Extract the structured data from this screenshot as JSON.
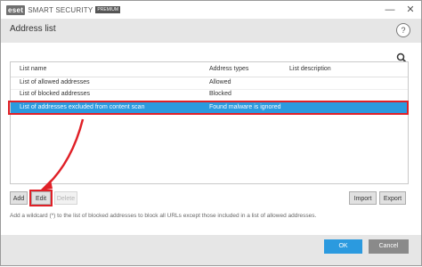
{
  "window": {
    "logo_mark": "eset",
    "product_name": "SMART SECURITY",
    "edition_badge": "PREMIUM",
    "minimize_icon": "minimize-icon",
    "close_icon": "close-icon"
  },
  "header": {
    "title": "Address list",
    "help_label": "?"
  },
  "table": {
    "columns": [
      "List name",
      "Address types",
      "List description"
    ],
    "rows": [
      {
        "name": "List of allowed addresses",
        "type": "Allowed",
        "description": ""
      },
      {
        "name": "List of blocked addresses",
        "type": "Blocked",
        "description": ""
      },
      {
        "name": "List of addresses excluded from content scan",
        "type": "Found malware is ignored",
        "description": ""
      }
    ],
    "selected_row": 2
  },
  "actions": {
    "add": "Add",
    "edit": "Edit",
    "delete": "Delete",
    "import": "Import",
    "export": "Export"
  },
  "hint": "Add a wildcard (*) to the list of blocked addresses to block all URLs except those included in a list of allowed addresses.",
  "footer": {
    "ok": "OK",
    "cancel": "Cancel"
  },
  "colors": {
    "accent": "#2b9adf",
    "highlight_annotation": "#e02027",
    "header_bg": "#e6e6e6"
  }
}
